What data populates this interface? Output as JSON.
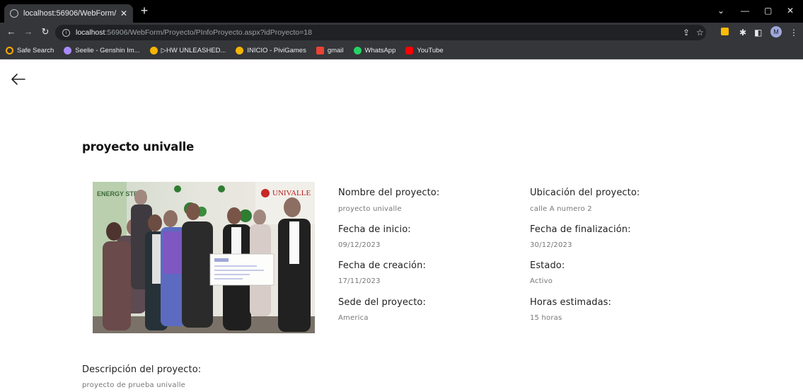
{
  "browser": {
    "tab_title": "localhost:56906/WebForm/Proy",
    "url_host": "localhost",
    "url_rest": ":56906/WebForm/Proyecto/PInfoProyecto.aspx?idProyecto=18",
    "bookmarks": [
      {
        "label": "Safe Search",
        "color": "#f9ab00"
      },
      {
        "label": "Seelie - Genshin Im...",
        "color": "#a78bfa"
      },
      {
        "label": "▷HW UNLEASHED...",
        "color": "#f5b400"
      },
      {
        "label": "INICIO - PiviGames",
        "color": "#f5b400"
      },
      {
        "label": "gmail",
        "color": "#ea4335"
      },
      {
        "label": "WhatsApp",
        "color": "#25d366"
      },
      {
        "label": "YouTube",
        "color": "#ff0000"
      }
    ],
    "avatar_letter": "M"
  },
  "page": {
    "title": "proyecto univalle",
    "photo_banner": "UNIVALLE",
    "photo_banner_left": "ENERGY STEPS",
    "fields": {
      "nombre": {
        "label": "Nombre del proyecto:",
        "value": "proyecto univalle"
      },
      "ubicacion": {
        "label": "Ubicación del proyecto:",
        "value": "calle A numero 2"
      },
      "fecha_inicio": {
        "label": "Fecha de inicio:",
        "value": "09/12/2023"
      },
      "fecha_fin": {
        "label": "Fecha de finalización:",
        "value": "30/12/2023"
      },
      "fecha_creacion": {
        "label": "Fecha de creación:",
        "value": "17/11/2023"
      },
      "estado": {
        "label": "Estado:",
        "value": "Activo"
      },
      "sede": {
        "label": "Sede del proyecto:",
        "value": "America"
      },
      "horas": {
        "label": "Horas estimadas:",
        "value": "15 horas"
      },
      "descripcion": {
        "label": "Descripción del proyecto:",
        "value": "proyecto de prueba univalle"
      }
    }
  }
}
